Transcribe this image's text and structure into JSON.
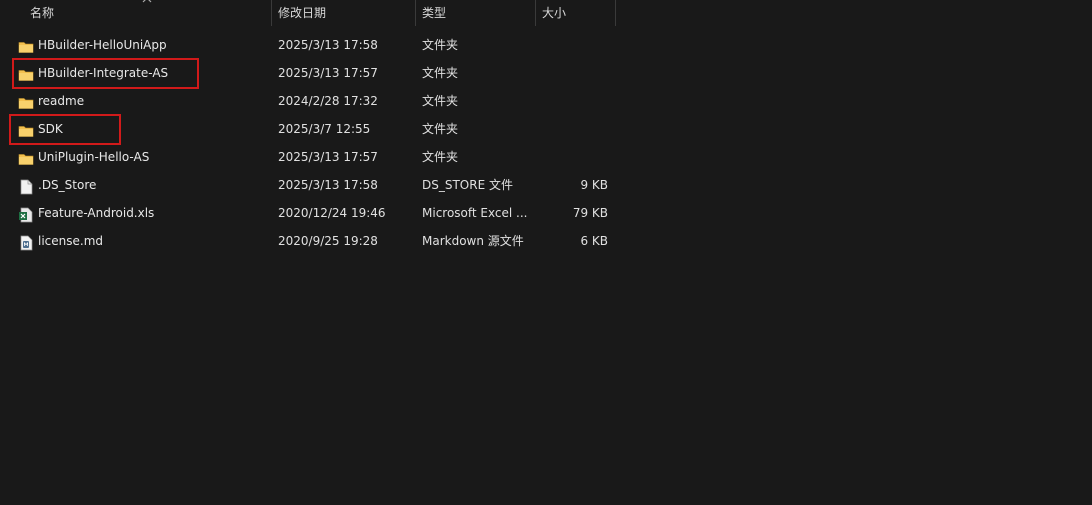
{
  "columns": {
    "name": "名称",
    "modified": "修改日期",
    "type": "类型",
    "size": "大小"
  },
  "files": [
    {
      "name": "HBuilder-HelloUniApp",
      "modified": "2025/3/13 17:58",
      "type": "文件夹",
      "size": "",
      "icon": "folder-icon"
    },
    {
      "name": "HBuilder-Integrate-AS",
      "modified": "2025/3/13 17:57",
      "type": "文件夹",
      "size": "",
      "icon": "folder-icon",
      "highlighted": true
    },
    {
      "name": "readme",
      "modified": "2024/2/28 17:32",
      "type": "文件夹",
      "size": "",
      "icon": "folder-icon"
    },
    {
      "name": "SDK",
      "modified": "2025/3/7 12:55",
      "type": "文件夹",
      "size": "",
      "icon": "folder-icon",
      "highlighted": true
    },
    {
      "name": "UniPlugin-Hello-AS",
      "modified": "2025/3/13 17:57",
      "type": "文件夹",
      "size": "",
      "icon": "folder-icon"
    },
    {
      "name": ".DS_Store",
      "modified": "2025/3/13 17:58",
      "type": "DS_STORE 文件",
      "size": "9 KB",
      "icon": "file-icon"
    },
    {
      "name": "Feature-Android.xls",
      "modified": "2020/12/24 19:46",
      "type": "Microsoft Excel ...",
      "size": "79 KB",
      "icon": "excel-icon"
    },
    {
      "name": "license.md",
      "modified": "2020/9/25 19:28",
      "type": "Markdown 源文件",
      "size": "6 KB",
      "icon": "markdown-icon"
    }
  ],
  "colors": {
    "background": "#191919",
    "text": "#e8e8e8",
    "folder": "#f3c04f",
    "highlight": "#d11a1a",
    "separator": "#3a3a3a"
  }
}
